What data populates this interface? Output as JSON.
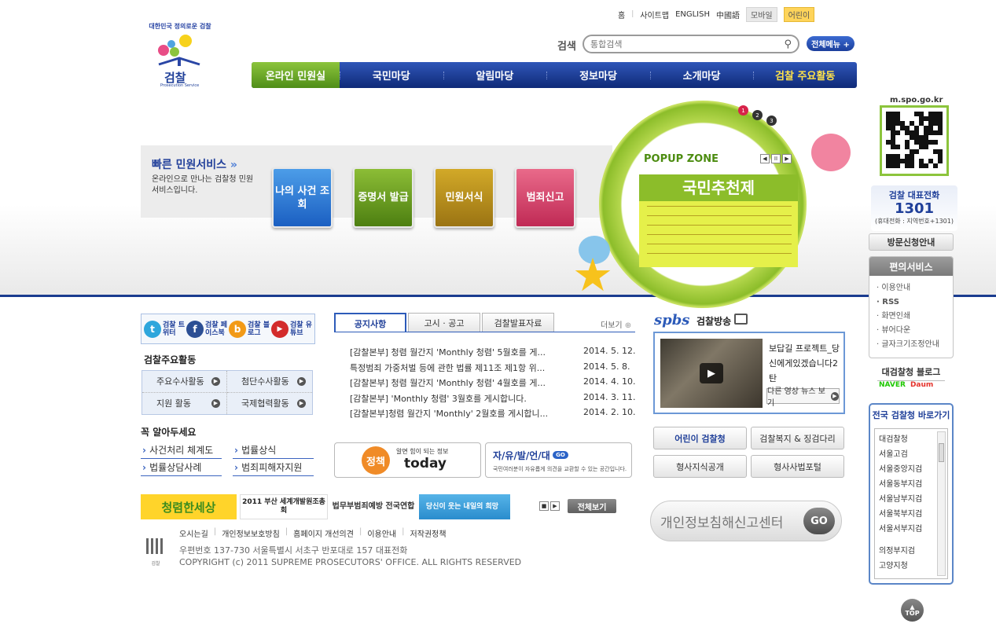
{
  "header": {
    "logo_text": "검찰",
    "logo_sub": "Prosecution Service",
    "logo_ring": "대한민국 정의로운 검찰",
    "util_links": [
      "홈",
      "사이트맵",
      "ENGLISH",
      "中國語"
    ],
    "util_tags": [
      "모바일",
      "어린이"
    ],
    "search_label": "검색",
    "search_placeholder": "통합검색",
    "all_menu": "전체메뉴 +"
  },
  "gnb": [
    "온라인 민원실",
    "국민마당",
    "알림마당",
    "정보마당",
    "소개마당",
    "검찰 주요활동"
  ],
  "quick": {
    "title": "빠른 민원서비스",
    "desc": "온라인으로 만나는 검찰청 민원 서비스입니다.",
    "buttons": [
      "나의 사건 조회",
      "증명서 발급",
      "민원서식",
      "범죄신고"
    ]
  },
  "popup": {
    "title": "POPUP ZONE",
    "pages": [
      "1",
      "2",
      "3"
    ],
    "banner_title": "국민추천제"
  },
  "right": {
    "qr_label": "m.spo.go.kr",
    "tel_label": "검찰 대표전화",
    "tel_number": "1301",
    "tel_note": "(휴대전화 : 지역번호+1301)",
    "visit": "방문신청안내",
    "conv_title": "편의서비스",
    "conv_items": [
      "이용안내",
      "RSS",
      "화면인쇄",
      "뷰어다운",
      "글자크기조정안내"
    ],
    "blog_label": "대검찰청 블로그",
    "blog_logos": [
      "NAVER",
      "Daum"
    ],
    "nation_title": "전국 검찰청 바로가기",
    "nation_items": [
      "대검찰청",
      "서울고검",
      "서울중앙지검",
      "서울동부지검",
      "서울남부지검",
      "서울북부지검",
      "서울서부지검",
      "의정부지검",
      "고양지청"
    ],
    "top": "TOP"
  },
  "sns": [
    {
      "label": "검찰 트위터",
      "icon": "twitter-icon",
      "glyph": "t"
    },
    {
      "label": "검찰 페이스북",
      "icon": "facebook-icon",
      "glyph": "f"
    },
    {
      "label": "검찰 블로그",
      "icon": "blog-icon",
      "glyph": "b"
    },
    {
      "label": "검찰 유튜브",
      "icon": "youtube-icon",
      "glyph": "▶"
    }
  ],
  "main_activities": {
    "title": "검찰주요활동",
    "items": [
      "주요수사활동",
      "첨단수사활동",
      "지원 활동",
      "국제협력활동"
    ]
  },
  "must_know": {
    "title": "꼭 알아두세요",
    "items": [
      "사건처리 체계도",
      "법률상식",
      "법률상담사례",
      "범죄피해자지원"
    ]
  },
  "notice": {
    "tabs": [
      "공지사항",
      "고시 · 공고",
      "검찰발표자료"
    ],
    "more": "더보기",
    "rows": [
      {
        "title": "[감찰본부] 청렴 월간지 'Monthly 청렴' 5월호를 게...",
        "date": "2014. 5. 12."
      },
      {
        "title": "특정범죄 가중처벌 등에 관한 법률 제11조 제1항 위...",
        "date": "2014. 5. 8."
      },
      {
        "title": "[감찰본부] 청렴 월간지 'Monthly 청렴' 4월호를 게...",
        "date": "2014. 4. 10."
      },
      {
        "title": "[감찰본부] 'Monthly 청렴' 3월호를 게시합니다.",
        "date": "2014. 3. 11."
      },
      {
        "title": "[감찰본부]청렴 월간지 'Monthly' 2월호를 게시합니...",
        "date": "2014. 2. 10."
      }
    ]
  },
  "banners": {
    "today_small": "알면 힘이 되는 정보",
    "today_circle": "정책",
    "today_big": "today",
    "free_big": "자/유/발/언/대",
    "free_go": "GO",
    "free_small": "국민여러분이 자유롭게 의견을 교환할 수 있는 공간입니다."
  },
  "media": {
    "logo": "spbs",
    "title": "검찰방송",
    "caption": "보답길 프로젝트_당신에게있겠습니다2탄",
    "more": "다른 영상 뉴스 보기"
  },
  "service_buttons": [
    "어린이 검찰청",
    "검찰복지 & 징검다리",
    "형사지식공개",
    "형사사법포털"
  ],
  "privacy": {
    "text": "개인정보침해신고센터",
    "go": "GO"
  },
  "strip": {
    "b1": "청렴한세상",
    "b2": "2011 부산 세계개발원조총회",
    "b3": "법무부범죄예방 전국연합",
    "b4": "당신이 웃는 내일의 희망",
    "view_all": "전체보기"
  },
  "footer": {
    "links": [
      "오시는길",
      "개인정보보호방침",
      "홈페이지 개선의견",
      "이용안내",
      "저작권정책"
    ],
    "address": "우편번호 137-730 서울특별시 서초구 반포대로 157  대표전화",
    "copyright": "COPYRIGHT (c) 2011 SUPREME PROSECUTORS' OFFICE. ALL RIGHTS RESERVED",
    "logo_text": "검찰"
  }
}
